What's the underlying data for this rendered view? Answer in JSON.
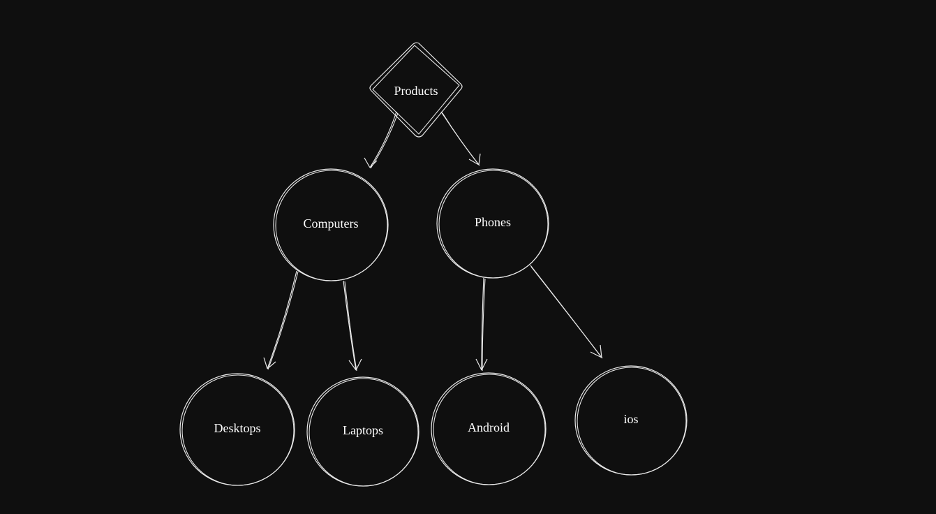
{
  "diagram": {
    "root": {
      "label": "Products",
      "shape": "diamond"
    },
    "level1": [
      {
        "id": "computers",
        "label": "Computers"
      },
      {
        "id": "phones",
        "label": "Phones"
      }
    ],
    "level2": [
      {
        "id": "desktops",
        "parent": "computers",
        "label": "Desktops"
      },
      {
        "id": "laptops",
        "parent": "computers",
        "label": "Laptops"
      },
      {
        "id": "android",
        "parent": "phones",
        "label": "Android"
      },
      {
        "id": "ios",
        "parent": "phones",
        "label": "ios"
      }
    ],
    "edges": [
      {
        "from": "root",
        "to": "computers"
      },
      {
        "from": "root",
        "to": "phones"
      },
      {
        "from": "computers",
        "to": "desktops"
      },
      {
        "from": "computers",
        "to": "laptops"
      },
      {
        "from": "phones",
        "to": "android"
      },
      {
        "from": "phones",
        "to": "ios"
      }
    ]
  }
}
